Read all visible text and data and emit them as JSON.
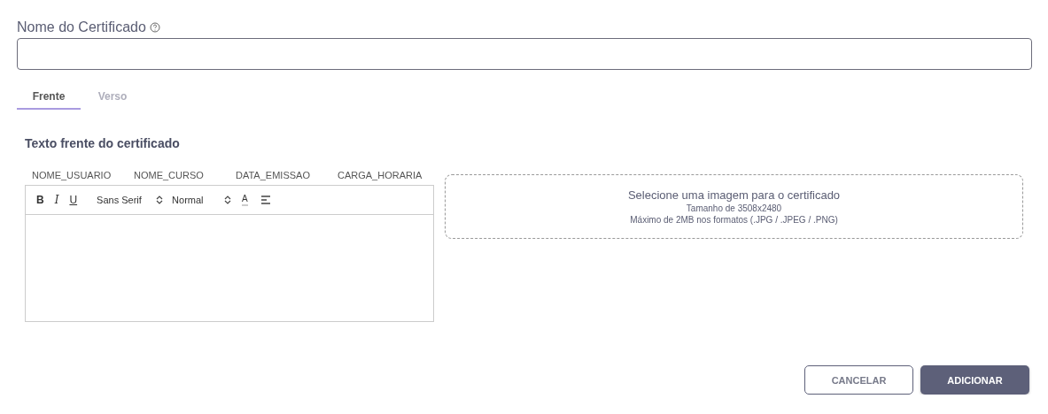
{
  "field": {
    "label": "Nome do Certificado"
  },
  "tabs": [
    {
      "label": "Frente",
      "selected": true
    },
    {
      "label": "Verso",
      "selected": false
    }
  ],
  "section_title": "Texto frente do certificado",
  "variables": [
    "NOME_USUARIO",
    "NOME_CURSO",
    "DATA_EMISSAO",
    "CARGA_HORARIA"
  ],
  "toolbar": [
    {
      "kind": "bold",
      "text": "B"
    },
    {
      "kind": "italic",
      "text": "I"
    },
    {
      "kind": "underline",
      "text": "U"
    },
    {
      "kind": "select",
      "text": "Sans Serif"
    },
    {
      "kind": "select",
      "text": "Normal"
    },
    {
      "kind": "color",
      "text": "A"
    },
    {
      "kind": "align"
    }
  ],
  "dropzone": {
    "title": "Selecione uma imagem para o certificado",
    "size": "Tamanho de 3508x2480",
    "formats": "Máximo de 2MB nos formatos (.JPG / .JPEG / .PNG)"
  },
  "buttons": [
    {
      "label": "CANCELAR",
      "kind": "outline"
    },
    {
      "label": "ADICIONAR",
      "kind": "primary"
    }
  ]
}
